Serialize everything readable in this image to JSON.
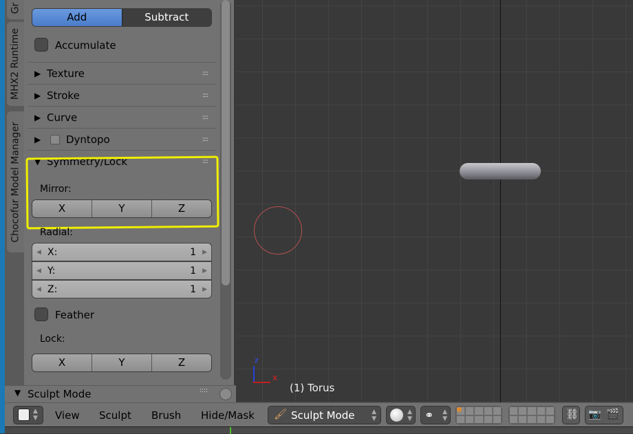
{
  "tabs": [
    "Gr",
    "MHX2 Runtime",
    "Chocofur Model Manager"
  ],
  "brush": {
    "add": "Add",
    "subtract": "Subtract",
    "accumulate": "Accumulate"
  },
  "subpanels": [
    "Texture",
    "Stroke",
    "Curve",
    "Dyntopo"
  ],
  "symmetry": {
    "title": "Symmetry/Lock",
    "mirror_label": "Mirror:",
    "mirror": [
      "X",
      "Y",
      "Z"
    ],
    "radial_label": "Radial:",
    "radial": [
      {
        "axis": "X:",
        "value": "1"
      },
      {
        "axis": "Y:",
        "value": "1"
      },
      {
        "axis": "Z:",
        "value": "1"
      }
    ],
    "feather": "Feather",
    "lock_label": "Lock:",
    "lock": [
      "X",
      "Y",
      "Z"
    ]
  },
  "sculpt_panel": "Sculpt Mode",
  "viewport": {
    "object_label": "(1) Torus",
    "axis_x": "x",
    "axis_z": "z",
    "highlight_color": "#f0f000"
  },
  "header": {
    "menus": [
      "View",
      "Sculpt",
      "Brush",
      "Hide/Mask"
    ],
    "mode": "Sculpt Mode"
  }
}
